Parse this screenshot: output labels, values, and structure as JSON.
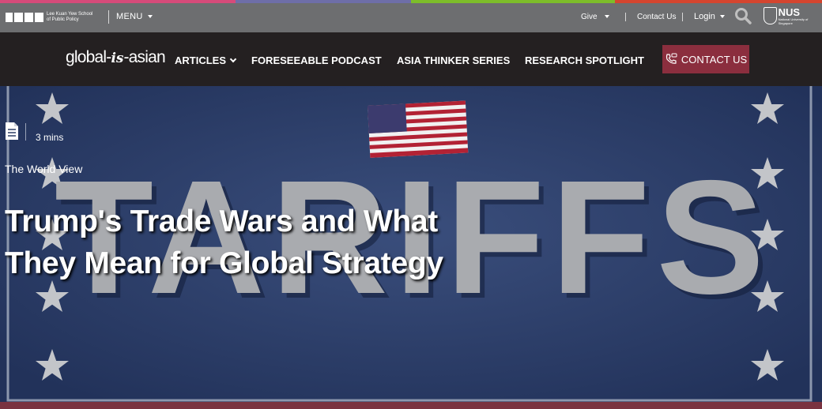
{
  "colors": {
    "strip": [
      "#d64b7a",
      "#6e6ea8",
      "#7dbd2a",
      "#d4452f"
    ],
    "util_bar": "#6d6e70",
    "nav_bar": "#242021",
    "contact_button": "#8b2e3e",
    "hero_bg": "#2d3f66"
  },
  "utility_bar": {
    "school_name": "Lee Kuan Yew School of Public Policy",
    "menu_label": "MENU",
    "give_label": "Give",
    "contact_label": "Contact Us",
    "login_label": "Login",
    "search_icon": "search-icon",
    "nus_label": "NUS",
    "nus_subtext": "National University of Singapore"
  },
  "nav": {
    "brand_part1": "global-",
    "brand_part2": "is",
    "brand_part3": "-asian",
    "items": [
      {
        "label": "ARTICLES"
      },
      {
        "label": "FORESEEABLE PODCAST"
      },
      {
        "label": "ASIA THINKER SERIES"
      },
      {
        "label": "RESEARCH SPOTLIGHT"
      }
    ],
    "contact_label": "CONTACT US"
  },
  "hero": {
    "read_time": "3 mins",
    "article_icon": "document-icon",
    "category": "The World View",
    "title": "Trump's Trade Wars and What They Mean for Global Strategy",
    "background_word": "TARIFFS"
  }
}
